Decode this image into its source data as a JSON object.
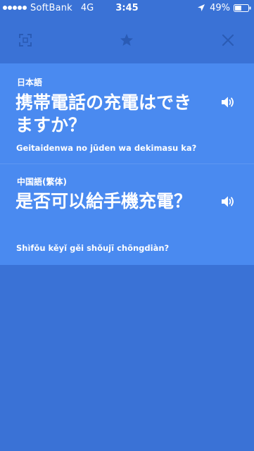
{
  "status_bar": {
    "carrier": "SoftBank",
    "network": "4G",
    "time": "3:45",
    "battery_percent": "49%",
    "battery_level": 0.49,
    "icons": [
      "signal-dots-icon",
      "location-arrow-icon",
      "battery-icon"
    ]
  },
  "toolbar": {
    "icons": [
      "fullscreen-icon",
      "star-icon",
      "close-icon"
    ]
  },
  "translations": [
    {
      "language": "日本語",
      "text": "携帯電話の充電はできますか？",
      "romanization": "Geitaidenwa no jūden wa dekimasu ka?",
      "icon": "speaker-icon"
    },
    {
      "language": "中国語(繁体)",
      "text": "是否可以給手機充電？",
      "romanization": "Shìfǒu kěyǐ gěi shǒujī chōngdiàn?",
      "icon": "speaker-icon"
    }
  ],
  "colors": {
    "background": "#3a72d6",
    "card": "#4a8af0",
    "toolbar_icon": "#2a5bb5"
  }
}
